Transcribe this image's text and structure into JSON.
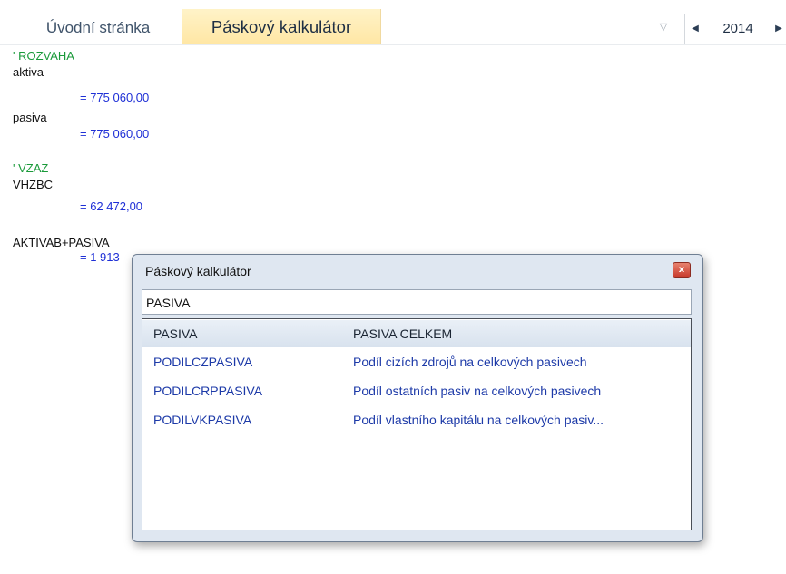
{
  "tabs": [
    {
      "label": "Úvodní stránka",
      "active": false
    },
    {
      "label": "Páskový kalkulátor",
      "active": true
    }
  ],
  "header": {
    "dropdown_icon": "triangle-down-icon",
    "year": "2014",
    "prev_symbol": "◀",
    "next_symbol": "▶"
  },
  "tape": {
    "lines": [
      {
        "kind": "comment",
        "text": "' ROZVAHA"
      },
      {
        "kind": "label",
        "text": "aktiva"
      },
      {
        "kind": "result",
        "text": "= 775 060,00"
      },
      {
        "kind": "label",
        "text": "pasiva"
      },
      {
        "kind": "result",
        "text": "= 775 060,00"
      },
      {
        "kind": "comment",
        "text": "' VZAZ"
      },
      {
        "kind": "label",
        "text": "VHZBC"
      },
      {
        "kind": "result",
        "text": "= 62 472,00"
      },
      {
        "kind": "label",
        "text": "AKTIVAB+PASIVA"
      },
      {
        "kind": "result",
        "text": "= 1 913"
      }
    ]
  },
  "dialog": {
    "title": "Páskový kalkulátor",
    "close_symbol": "x",
    "input_value": "PASIVA",
    "rows": [
      {
        "code": "PASIVA",
        "description": "PASIVA CELKEM",
        "selected": true
      },
      {
        "code": "PODILCZPASIVA",
        "description": "Podíl cizích zdrojů na celkových pasivech",
        "selected": false
      },
      {
        "code": "PODILCRPPASIVA",
        "description": "Podíl ostatních pasiv na celkových pasivech",
        "selected": false
      },
      {
        "code": "PODILVKPASIVA",
        "description": "Podíl vlastního kapitálu na celkových pasiv...",
        "selected": false
      }
    ]
  },
  "colors": {
    "comment": "#1a9a3a",
    "result": "#1e2fd6",
    "active_tab": "#ffe6a3"
  }
}
